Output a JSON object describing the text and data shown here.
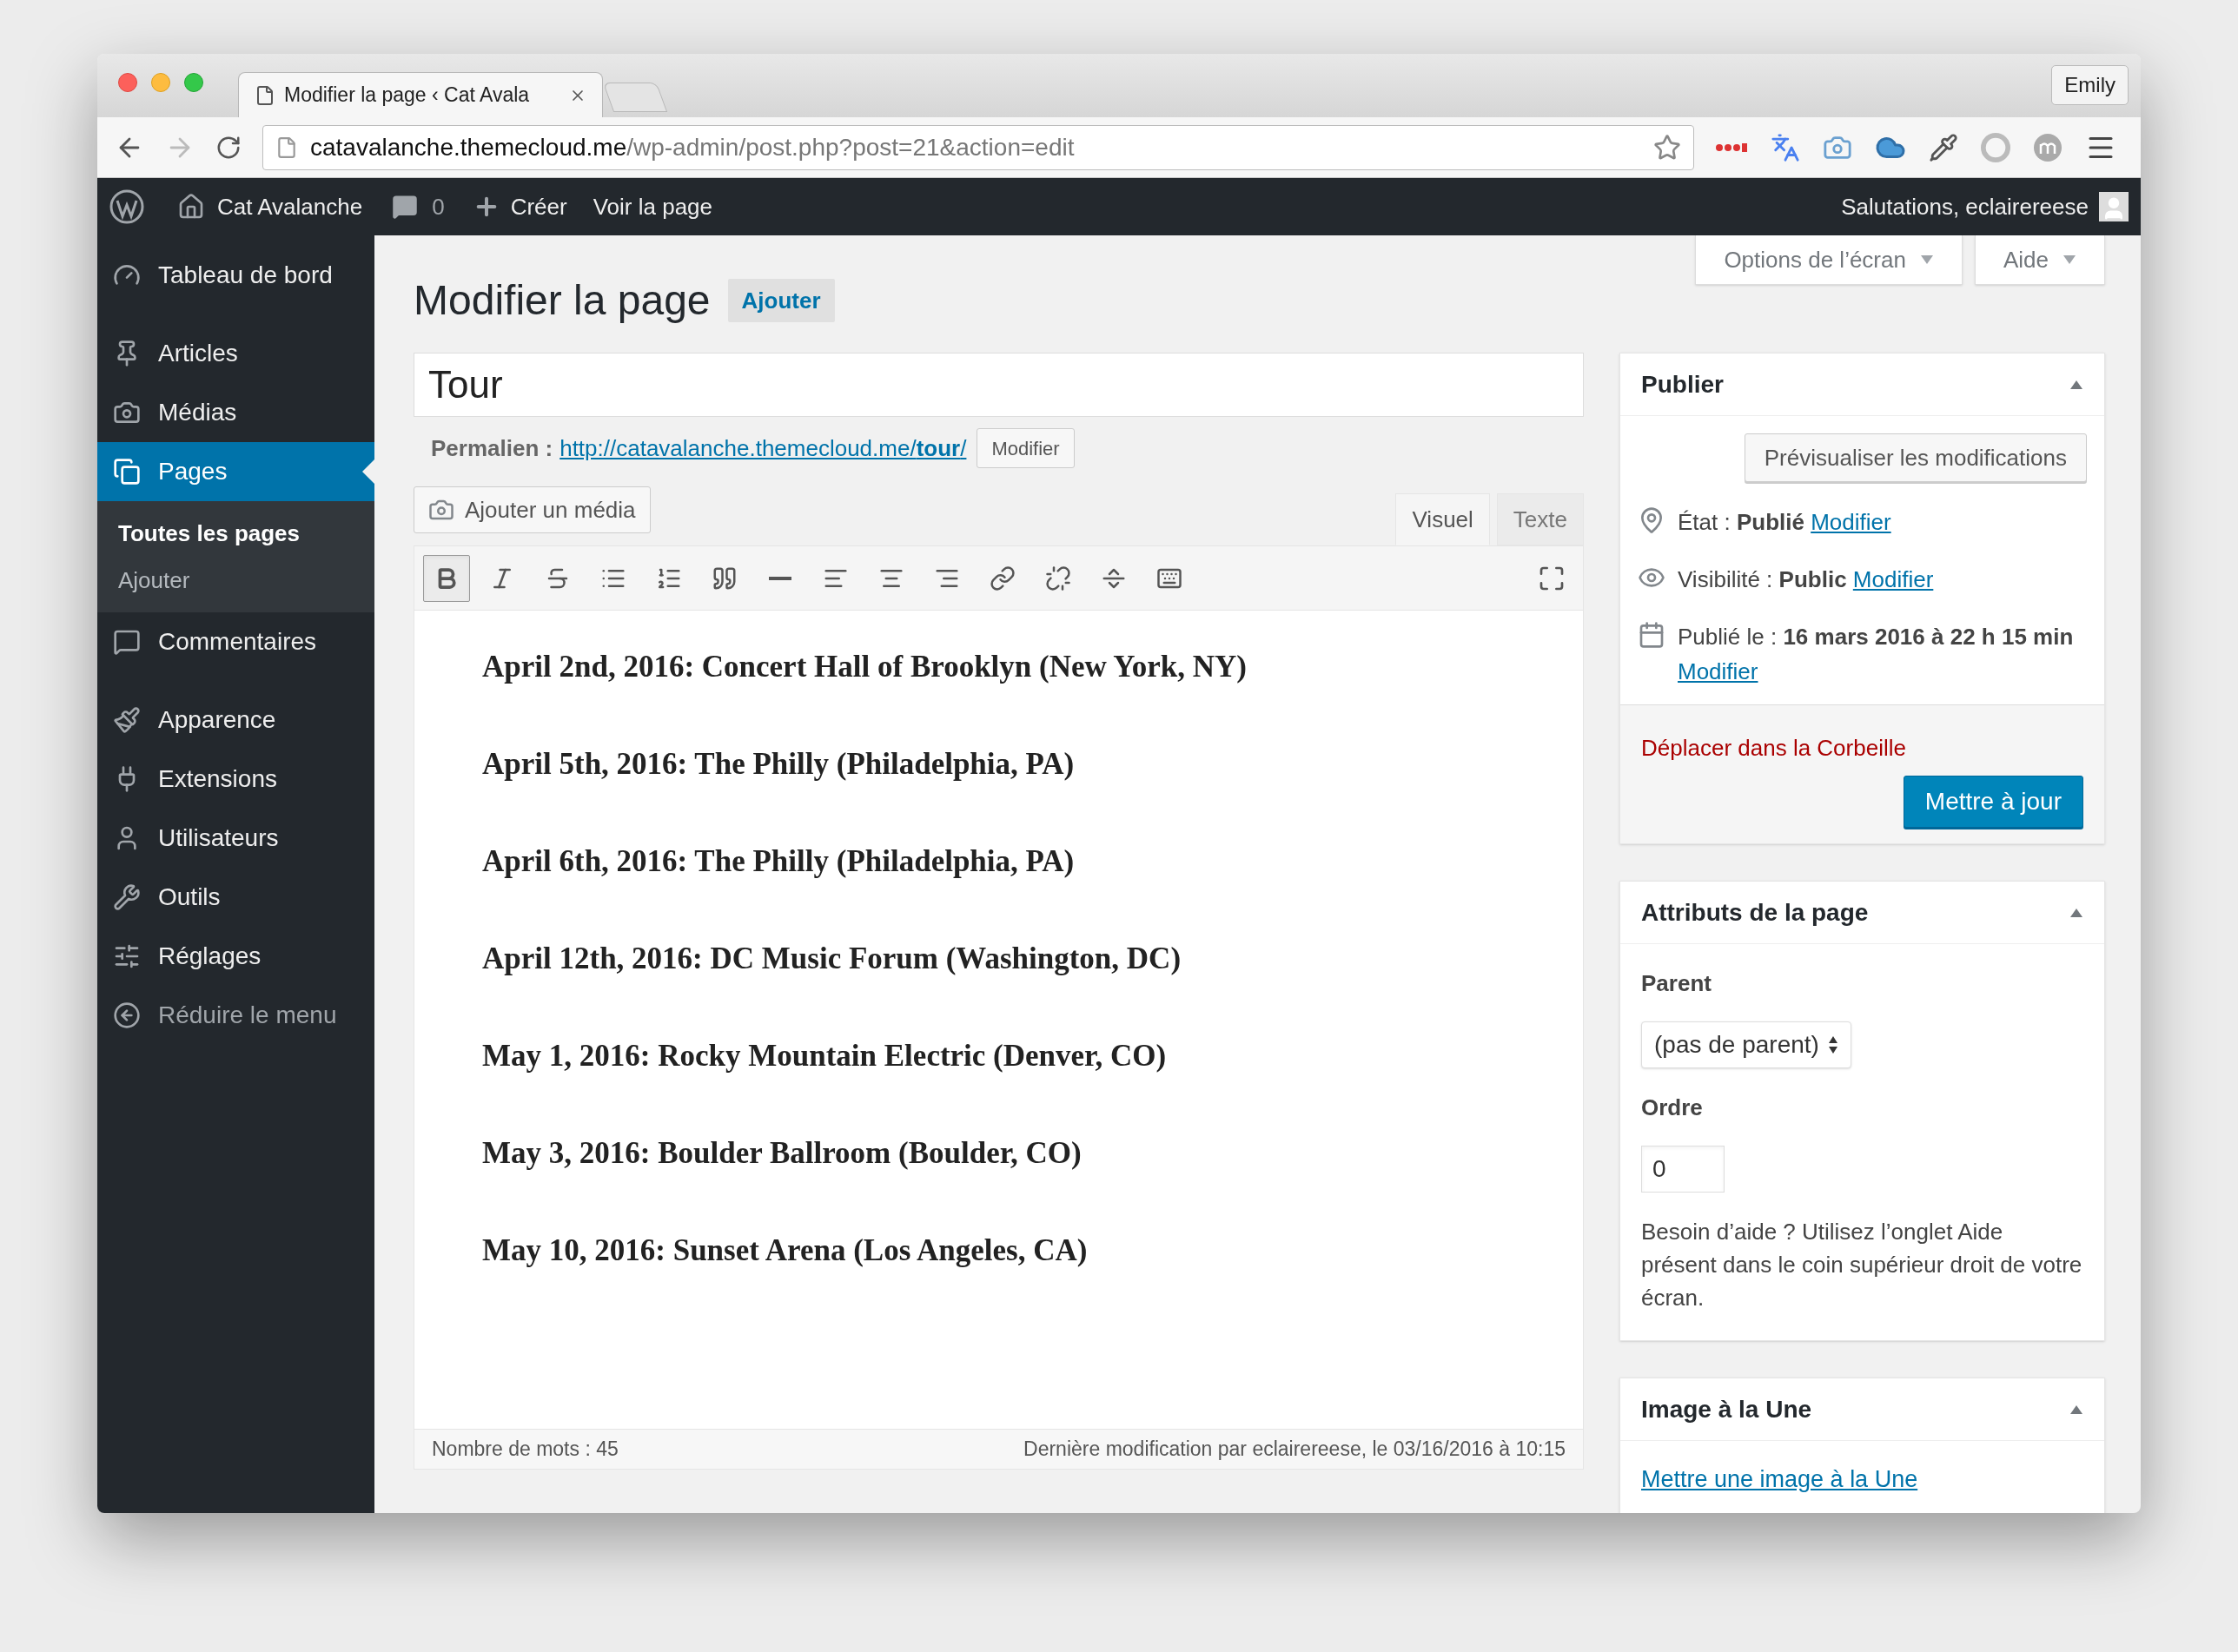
{
  "browser": {
    "tab_title": "Modifier la page ‹ Cat Avala",
    "profile": "Emily",
    "url_host": "catavalanche.themecloud.me",
    "url_path": "/wp-admin/post.php?post=21&action=edit"
  },
  "admin_bar": {
    "site": "Cat Avalanche",
    "comments": "0",
    "new": "Créer",
    "view": "Voir la page",
    "greeting": "Salutations, eclairereese"
  },
  "sidebar": {
    "groups": [
      [
        {
          "kind": "dashboard",
          "label": "Tableau de bord",
          "selected": false
        }
      ],
      [
        {
          "kind": "pin",
          "label": "Articles",
          "selected": false
        },
        {
          "kind": "media",
          "label": "Médias",
          "selected": false
        },
        {
          "kind": "pages",
          "label": "Pages",
          "selected": true,
          "children": [
            {
              "label": "Toutes les pages",
              "selected": true
            },
            {
              "label": "Ajouter",
              "selected": false
            }
          ]
        },
        {
          "kind": "comments",
          "label": "Commentaires",
          "selected": false
        }
      ],
      [
        {
          "kind": "brush",
          "label": "Apparence",
          "selected": false
        },
        {
          "kind": "plug",
          "label": "Extensions",
          "selected": false
        },
        {
          "kind": "user",
          "label": "Utilisateurs",
          "selected": false
        },
        {
          "kind": "wrench",
          "label": "Outils",
          "selected": false
        },
        {
          "kind": "settings",
          "label": "Réglages",
          "selected": false
        },
        {
          "kind": "collapse",
          "label": "Réduire le menu",
          "selected": false
        }
      ]
    ]
  },
  "screen_meta": [
    {
      "label": "Options de l’écran"
    },
    {
      "label": "Aide"
    }
  ],
  "header": {
    "title": "Modifier la page",
    "add": "Ajouter"
  },
  "title_field": {
    "value": "Tour"
  },
  "permalink": {
    "label": "Permalien :",
    "url": "http://catavalanche.themecloud.me/**tour**/",
    "button": "Modifier"
  },
  "media_button": "Ajouter un média",
  "editor_tabs": [
    {
      "label": "Visuel",
      "selected": true
    },
    {
      "label": "Texte",
      "selected": false
    }
  ],
  "toolbar": [
    {
      "kind": "bold",
      "active": true
    },
    {
      "kind": "italic",
      "active": false
    },
    {
      "kind": "strike",
      "active": false
    },
    {
      "kind": "bullets",
      "active": false
    },
    {
      "kind": "numbers",
      "active": false
    },
    {
      "kind": "quote",
      "active": false
    },
    {
      "kind": "rule",
      "active": false
    },
    {
      "kind": "align-left",
      "active": false
    },
    {
      "kind": "align-center",
      "active": false
    },
    {
      "kind": "align-right",
      "active": false
    },
    {
      "kind": "link",
      "active": false
    },
    {
      "kind": "unlink",
      "active": false
    },
    {
      "kind": "more",
      "active": false
    },
    {
      "kind": "keyboard",
      "active": false
    }
  ],
  "content": [
    "April 2nd, 2016: Concert Hall of Brooklyn (New York, NY)",
    "April 5th, 2016: The Philly (Philadelphia, PA)",
    "April 6th, 2016: The Philly (Philadelphia, PA)",
    "April 12th, 2016: DC Music Forum (Washington, DC)",
    "May 1, 2016: Rocky Mountain Electric (Denver, CO)",
    "May 3, 2016: Boulder Ballroom (Boulder, CO)",
    "May 10, 2016: Sunset Arena (Los Angeles, CA)"
  ],
  "status_bar": {
    "word_count": "Nombre de mots : 45",
    "last_modified": "Dernière modification par eclairereese, le 03/16/2016 à 10:15"
  },
  "publish": {
    "title": "Publier",
    "preview": "Prévisualiser les modifications",
    "rows": [
      {
        "kind": "status",
        "text": "État : **Publié**",
        "link": "Modifier"
      },
      {
        "kind": "visibility",
        "text": "Visibilité : **Public**",
        "link": "Modifier"
      },
      {
        "kind": "date",
        "text": "Publié le : **16 mars 2016 à 22 h 15 min**",
        "link": "Modifier"
      }
    ],
    "trash": "Déplacer dans la Corbeille",
    "update": "Mettre à jour"
  },
  "attributes": {
    "title": "Attributs de la page",
    "parent_label": "Parent",
    "parent_value": "(pas de parent)",
    "order_label": "Ordre",
    "order_value": "0",
    "help": "Besoin d’aide ? Utilisez l’onglet Aide présent dans le coin supérieur droit de votre écran."
  },
  "featured": {
    "title": "Image à la Une",
    "link": "Mettre une image à la Une"
  }
}
